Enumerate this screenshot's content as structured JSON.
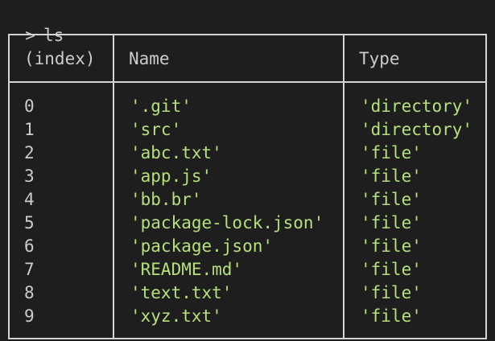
{
  "prompt": {
    "chevron": ">",
    "command": "ls"
  },
  "table": {
    "headers": {
      "index": "(index)",
      "name": "Name",
      "type": "Type"
    },
    "rows": [
      {
        "index": "0",
        "name": "'.git'",
        "type": "'directory'"
      },
      {
        "index": "1",
        "name": "'src'",
        "type": "'directory'"
      },
      {
        "index": "2",
        "name": "'abc.txt'",
        "type": "'file'"
      },
      {
        "index": "3",
        "name": "'app.js'",
        "type": "'file'"
      },
      {
        "index": "4",
        "name": "'bb.br'",
        "type": "'file'"
      },
      {
        "index": "5",
        "name": "'package-lock.json'",
        "type": "'file'"
      },
      {
        "index": "6",
        "name": "'package.json'",
        "type": "'file'"
      },
      {
        "index": "7",
        "name": "'README.md'",
        "type": "'file'"
      },
      {
        "index": "8",
        "name": "'text.txt'",
        "type": "'file'"
      },
      {
        "index": "9",
        "name": "'xyz.txt'",
        "type": "'file'"
      }
    ]
  },
  "colors": {
    "background": "#1e1e1e",
    "text": "#cccccc",
    "string": "#b5e07a",
    "border": "#d4d4d4"
  }
}
